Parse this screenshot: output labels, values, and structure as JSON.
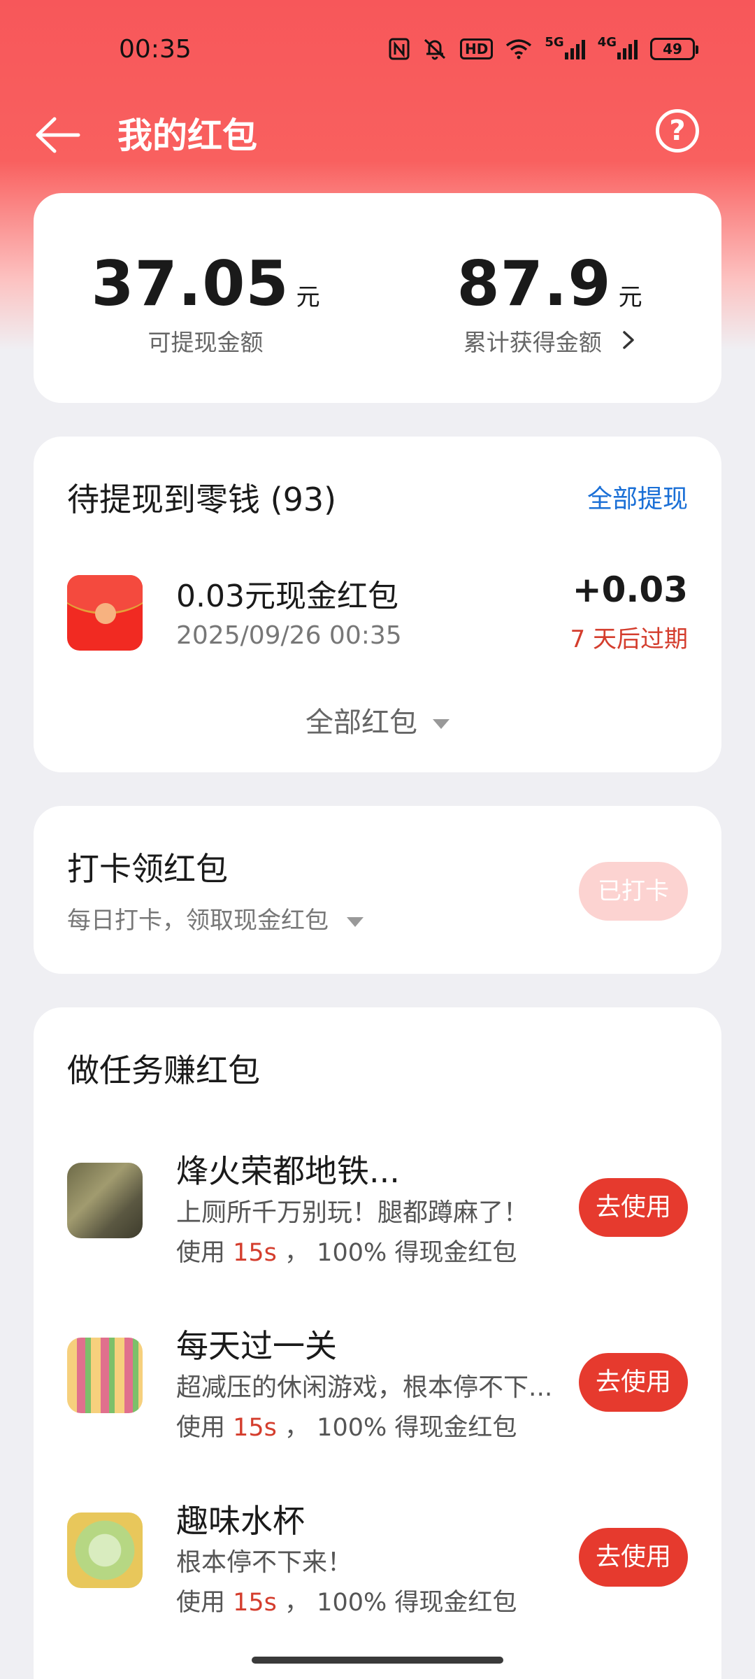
{
  "status_bar": {
    "time": "00:35",
    "battery": "49",
    "hd_label": "HD",
    "signal_5g": "5G",
    "signal_4g": "4G"
  },
  "header": {
    "title": "我的红包",
    "help_glyph": "?"
  },
  "balance": {
    "withdrawable_amount": "37.05",
    "withdrawable_unit": "元",
    "withdrawable_label": "可提现金额",
    "total_amount": "87.9",
    "total_unit": "元",
    "total_label": "累计获得金额"
  },
  "pending": {
    "title": "待提现到零钱 (93)",
    "withdraw_all": "全部提现",
    "item": {
      "title": "0.03元现金红包",
      "date": "2025/09/26 00:35",
      "amount": "+0.03",
      "expire": "7 天后过期"
    },
    "all_redpacks": "全部红包"
  },
  "checkin": {
    "title": "打卡领红包",
    "subtitle": "每日打卡，领取现金红包",
    "button": "已打卡"
  },
  "tasks": {
    "title": "做任务赚红包",
    "items": [
      {
        "title": "烽火荣都地铁...",
        "desc": "上厕所千万别玩！腿都蹲麻了！",
        "reward_prefix": "使用 ",
        "reward_time": "15s",
        "reward_suffix": " ， 100% 得现金红包",
        "button": "去使用"
      },
      {
        "title": "每天过一关",
        "desc": "超减压的休闲游戏，根本停不下...",
        "reward_prefix": "使用 ",
        "reward_time": "15s",
        "reward_suffix": " ， 100% 得现金红包",
        "button": "去使用"
      },
      {
        "title": "趣味水杯",
        "desc": "根本停不下来！",
        "reward_prefix": "使用 ",
        "reward_time": "15s",
        "reward_suffix": " ， 100% 得现金红包",
        "button": "去使用"
      }
    ]
  },
  "colors": {
    "header_red": "#f7575a",
    "accent_red": "#e63a2e",
    "link_blue": "#1a6fd6",
    "expire_red": "#d43d2d"
  }
}
